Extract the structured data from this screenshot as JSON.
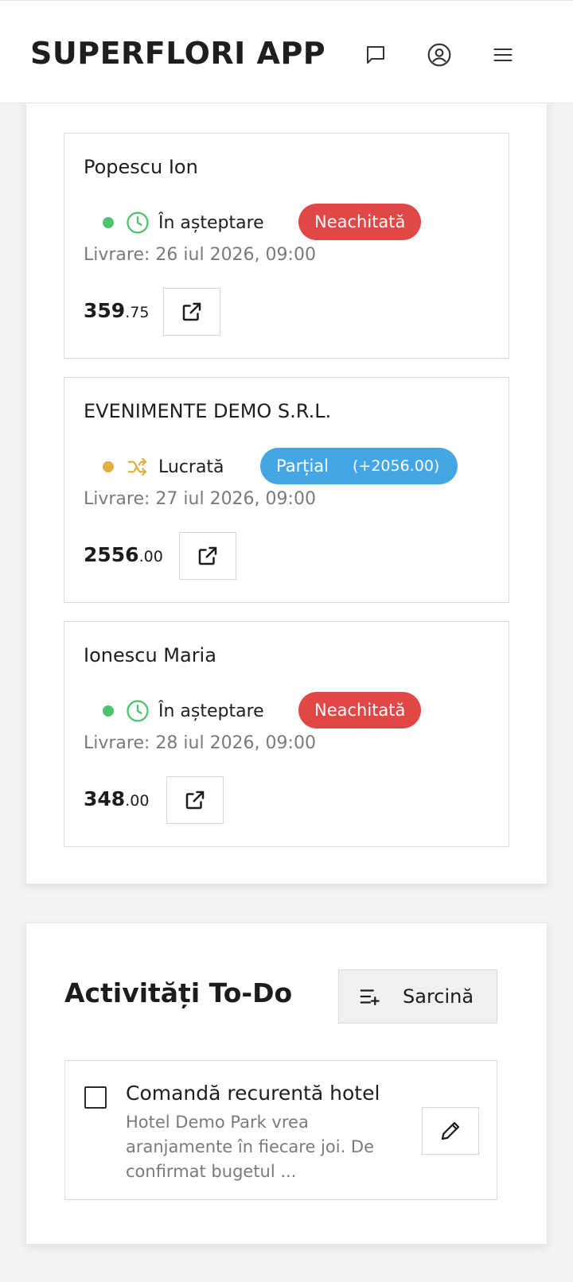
{
  "app": {
    "title": "SUPERFLORI APP"
  },
  "header_icons": [
    "chat-icon",
    "user-circle-icon",
    "menu-icon"
  ],
  "orders": [
    {
      "customer": "Popescu Ion",
      "status": {
        "label": "În așteptare",
        "dot_color": "#4cc26a",
        "icon": "clock-icon"
      },
      "payment": {
        "label": "Neachitată",
        "extra": "",
        "color": "#e04848"
      },
      "delivery": "Livrare: 26 iul 2026, 09:00",
      "amount_whole": "359",
      "amount_cents": ".75"
    },
    {
      "customer": "EVENIMENTE DEMO S.R.L.",
      "status": {
        "label": "Lucrată",
        "dot_color": "#e0b040",
        "icon": "shuffle-icon"
      },
      "payment": {
        "label": "Parțial",
        "extra": "(+2056.00)",
        "color": "#45a6e6"
      },
      "delivery": "Livrare: 27 iul 2026, 09:00",
      "amount_whole": "2556",
      "amount_cents": ".00"
    },
    {
      "customer": "Ionescu Maria",
      "status": {
        "label": "În așteptare",
        "dot_color": "#4cc26a",
        "icon": "clock-icon"
      },
      "payment": {
        "label": "Neachitată",
        "extra": "",
        "color": "#e04848"
      },
      "delivery": "Livrare: 28 iul 2026, 09:00",
      "amount_whole": "348",
      "amount_cents": ".00"
    }
  ],
  "todo": {
    "title": "Activități To-Do",
    "add_button_label": "Sarcină",
    "items": [
      {
        "title": "Comandă recurentă hotel",
        "description": "Hotel Demo Park vrea aranjamente în fiecare joi. De confirmat bugetul ...",
        "checked": false
      }
    ]
  }
}
